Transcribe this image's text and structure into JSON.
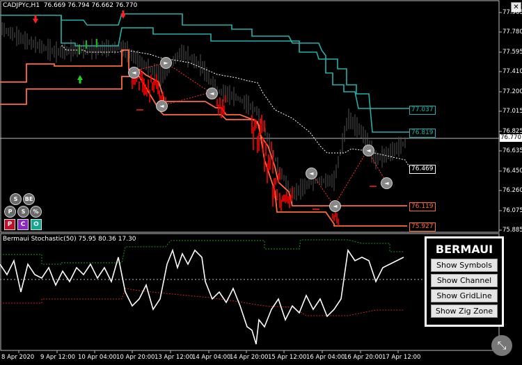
{
  "header": {
    "symbol_info": "CADJPYc,H1  76.669 76.794 76.662 76.770",
    "close_glyph": "✕"
  },
  "indicator": {
    "title": "Bermaui Stochastic(50) 75.95 80.36 17.30"
  },
  "price_axis": {
    "ticks": [
      "77.965",
      "77.780",
      "77.595",
      "77.410",
      "77.200",
      "77.015",
      "76.825",
      "76.635",
      "76.450",
      "76.260",
      "76.075",
      "75.885"
    ],
    "current_price": "76.770"
  },
  "price_labels": [
    {
      "text": "77.037",
      "color": "#20b2aa",
      "border": "#20b2aa"
    },
    {
      "text": "76.819",
      "color": "#20b2aa",
      "border": "#20b2aa"
    },
    {
      "text": "76.469",
      "color": "#ffffff",
      "border": "#ffffff"
    },
    {
      "text": "76.119",
      "color": "#ff6a3d",
      "border": "#ff6a3d"
    },
    {
      "text": "75.927",
      "color": "#ff6a3d",
      "border": "#ff6a3d"
    }
  ],
  "time_axis": [
    "8 Apr 2020",
    "9 Apr 12:00",
    "10 Apr 04:00",
    "10 Apr 20:00",
    "13 Apr 12:00",
    "14 Apr 04:00",
    "14 Apr 20:00",
    "15 Apr 12:00",
    "16 Apr 04:00",
    "16 Apr 20:00",
    "17 Apr 12:00"
  ],
  "panel": {
    "title": "BERMAUI",
    "buttons": [
      "Show Symbols",
      "Show Channel",
      "Show GridLine",
      "Show Zig Zone"
    ]
  },
  "mini_buttons": {
    "row1": [
      "S",
      "BE"
    ],
    "row2": [
      "P",
      "S",
      "%"
    ],
    "row3": [
      "P",
      "C",
      "O"
    ]
  },
  "zigzag_markers": [
    "◄",
    "►",
    "◄",
    "◄",
    "◄",
    "◄",
    "◄",
    "◄",
    "◄"
  ],
  "zoom_glyph": "⤡",
  "colors": {
    "teal_channel": "#20b2aa",
    "orange_channel": "#ff6a3d",
    "red_candles": "#ff0000",
    "stoch_line": "#ffffff",
    "stoch_upper": "#1f8f1f",
    "stoch_lower": "#cc2222"
  }
}
